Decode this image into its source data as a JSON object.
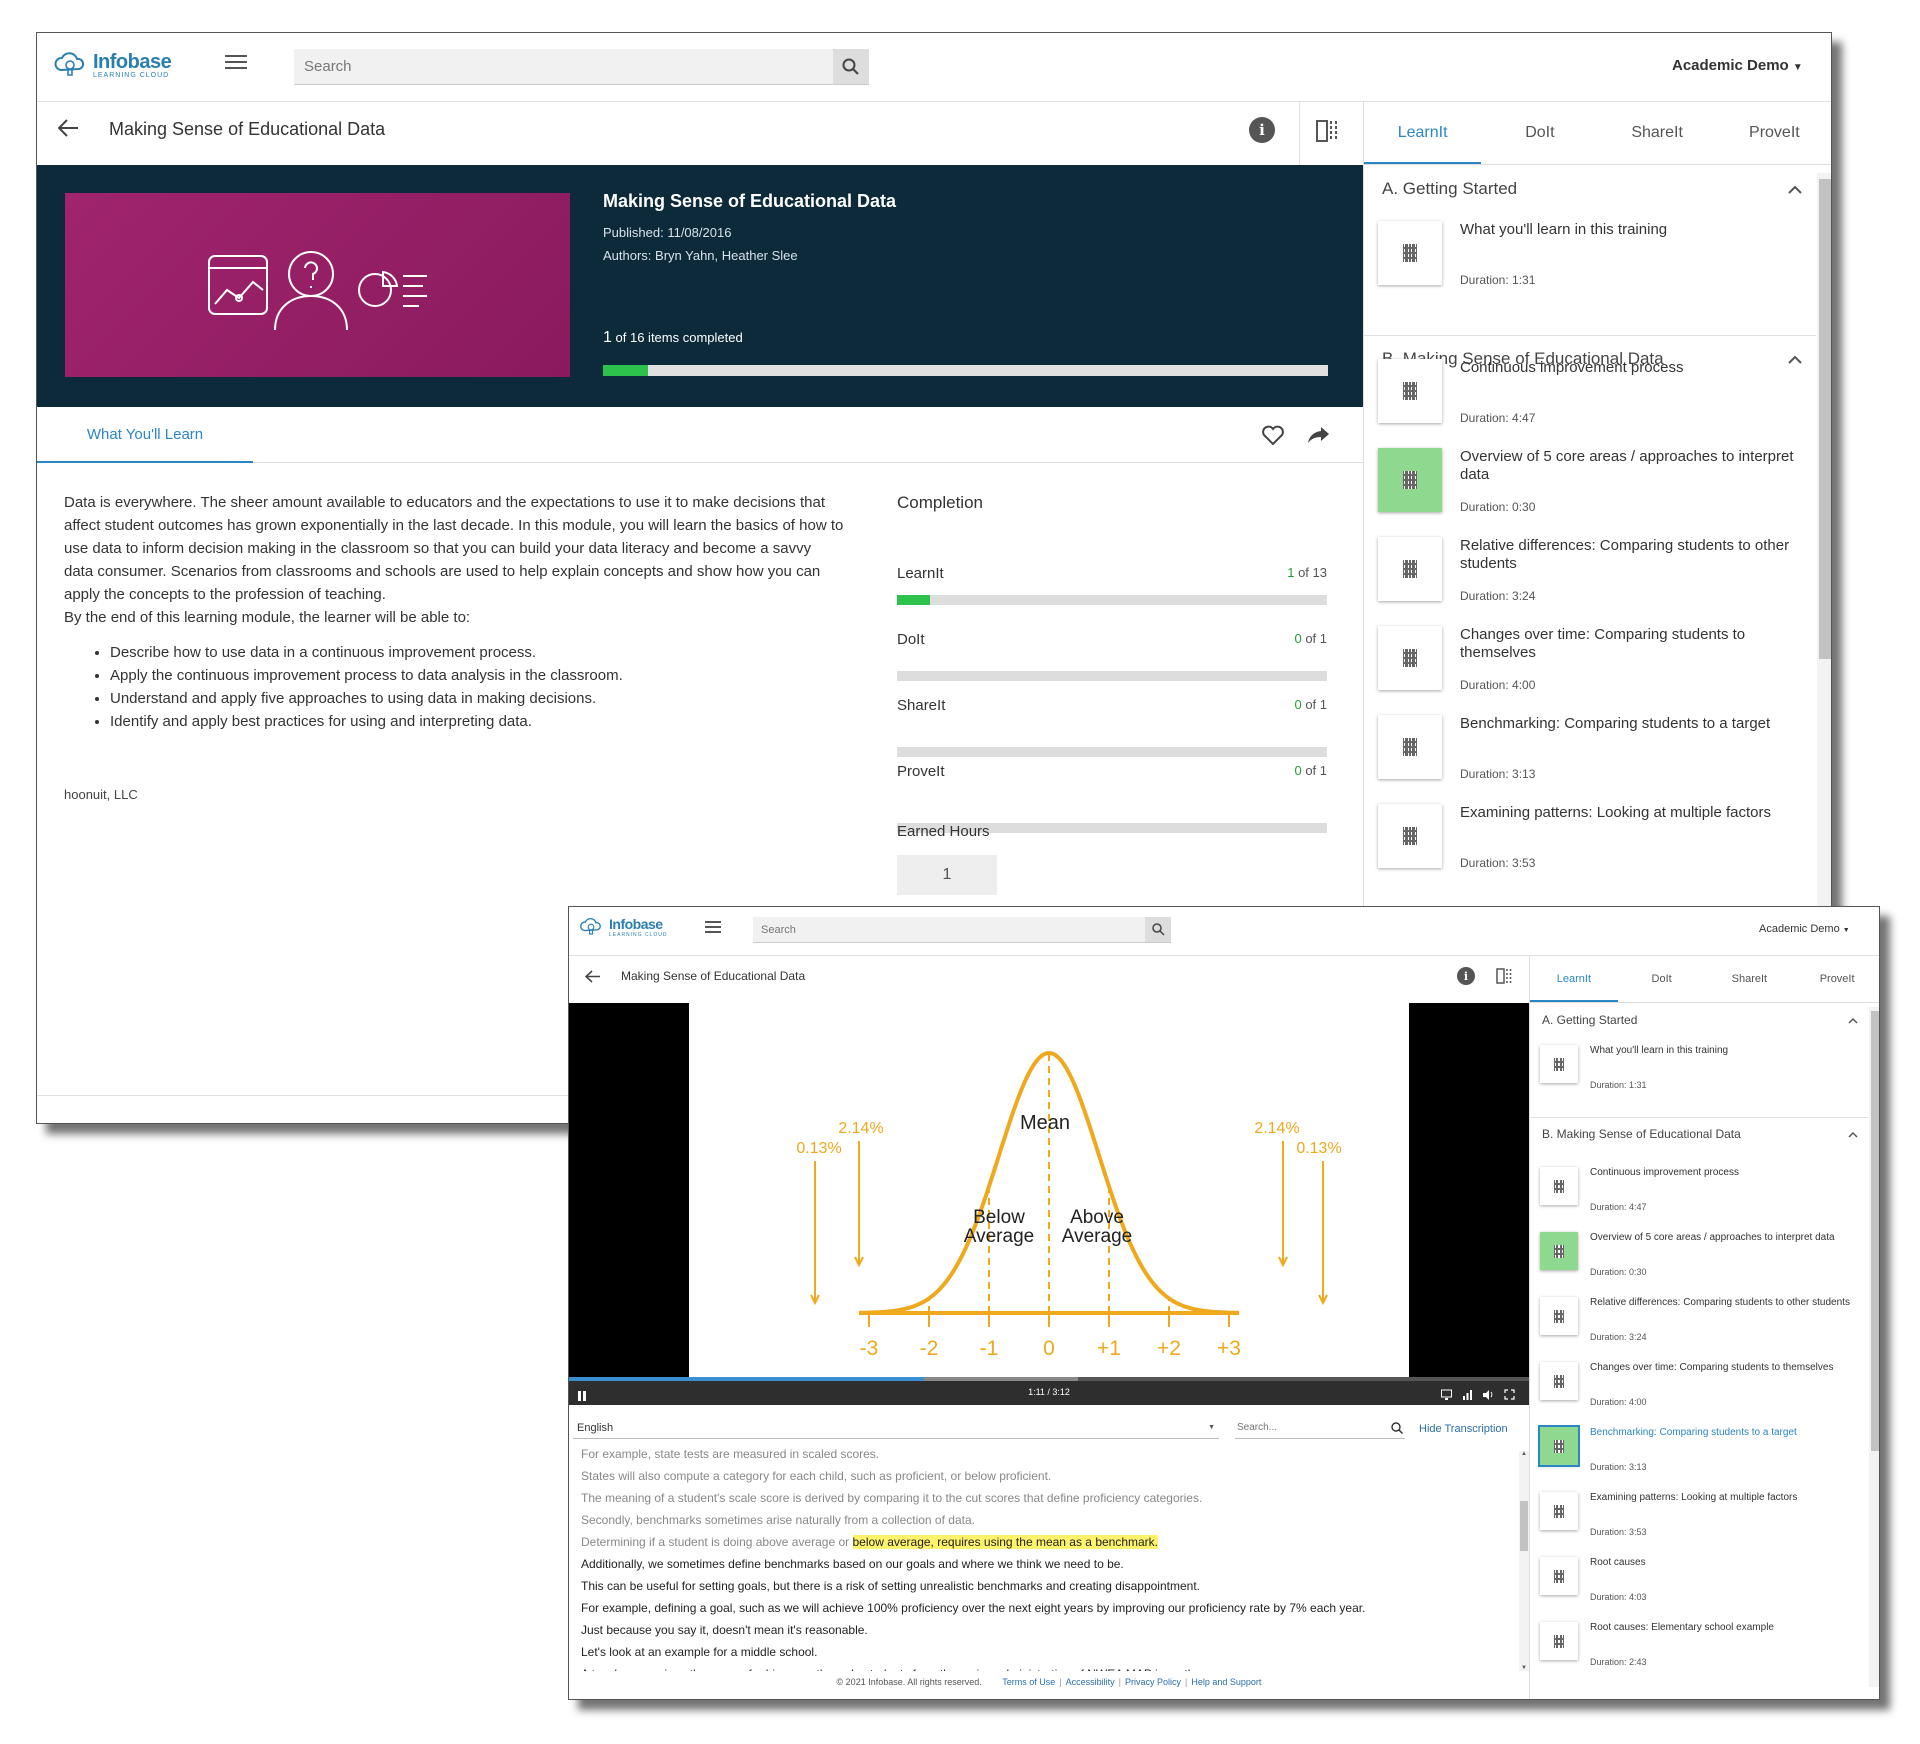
{
  "a": {
    "brand": "Infobase",
    "brand_sub": "LEARNING CLOUD",
    "search_placeholder": "Search",
    "user": "Academic Demo",
    "page_title": "Making Sense of Educational Data",
    "hero": {
      "title": "Making Sense of Educational Data",
      "published": "Published: 11/08/2016",
      "authors": "Authors: Bryn Yahn, Heather Slee",
      "progress_count": "1",
      "progress_text": "of 16 items completed",
      "progress_fraction": 0.0625
    },
    "tab_what": "What You'll Learn",
    "description": "Data is everywhere. The sheer amount available to educators and the expectations to use it to make decisions that affect student outcomes has grown exponentially in the last decade.  In this module, you will learn the basics of how to use data to inform decision making in the classroom so that you can build your data literacy and become a savvy data consumer.  Scenarios from classrooms and schools are used to help explain concepts and show how you can apply the concepts to the profession of teaching.",
    "description2": "By the end of this learning module, the learner will be able to:",
    "bullets": [
      "Describe how to use data in a continuous improvement process.",
      "Apply the continuous improvement process to data analysis in the classroom.",
      "Understand and apply five approaches to using data in making decisions.",
      "Identify and apply best practices for using and interpreting data."
    ],
    "publisher": "hoonuit, LLC",
    "completion_title": "Completion",
    "completion": [
      {
        "label": "LearnIt",
        "count": "1",
        "total": " of 13",
        "fraction": 0.077
      },
      {
        "label": "DoIt",
        "count": "0",
        "total": " of 1",
        "fraction": 0
      },
      {
        "label": "ShareIt",
        "count": "0",
        "total": " of 1",
        "fraction": 0
      },
      {
        "label": "ProveIt",
        "count": "0",
        "total": " of 1",
        "fraction": 0
      }
    ],
    "earned_label": "Earned Hours",
    "earned_value": "1",
    "tabs": [
      "LearnIt",
      "DoIt",
      "ShareIt",
      "ProveIt"
    ],
    "section_a": "A. Getting Started",
    "section_b": "B. Making Sense of Educational Data",
    "items_a": [
      {
        "title": "What you'll learn in this training",
        "duration": "Duration: 1:31"
      }
    ],
    "items_b": [
      {
        "title": "Continuous improvement process",
        "duration": "Duration: 4:47",
        "done": false
      },
      {
        "title": "Overview of 5 core areas / approaches to interpret data",
        "duration": "Duration: 0:30",
        "done": true
      },
      {
        "title": "Relative differences: Comparing students to other students",
        "duration": "Duration: 3:24",
        "done": false
      },
      {
        "title": "Changes over time: Comparing students to themselves",
        "duration": "Duration: 4:00",
        "done": false
      },
      {
        "title": "Benchmarking: Comparing students to a target",
        "duration": "Duration: 3:13",
        "done": false
      },
      {
        "title": "Examining patterns: Looking at multiple factors",
        "duration": "Duration: 3:53",
        "done": false
      }
    ]
  },
  "b": {
    "brand": "Infobase",
    "brand_sub": "LEARNING CLOUD",
    "search_placeholder": "Search",
    "user": "Academic Demo",
    "page_title": "Making Sense of Educational Data",
    "tabs": [
      "LearnIt",
      "DoIt",
      "ShareIt",
      "ProveIt"
    ],
    "section_a": "A. Getting Started",
    "section_b": "B. Making Sense of Educational Data",
    "items_a": [
      {
        "title": "What you'll learn in this training",
        "duration": "Duration: 1:31"
      }
    ],
    "items_b": [
      {
        "title": "Continuous improvement process",
        "duration": "Duration: 4:47",
        "done": false,
        "active": false
      },
      {
        "title": "Overview of 5 core areas / approaches to interpret data",
        "duration": "Duration: 0:30",
        "done": true,
        "active": false
      },
      {
        "title": "Relative differences: Comparing students to other students",
        "duration": "Duration: 3:24",
        "done": false,
        "active": false
      },
      {
        "title": "Changes over time: Comparing students to themselves",
        "duration": "Duration: 4:00",
        "done": false,
        "active": false
      },
      {
        "title": "Benchmarking: Comparing students to a target",
        "duration": "Duration: 3:13",
        "done": true,
        "active": true
      },
      {
        "title": "Examining patterns: Looking at multiple factors",
        "duration": "Duration: 3:53",
        "done": false,
        "active": false
      },
      {
        "title": "Root causes",
        "duration": "Duration: 4:03",
        "done": false,
        "active": false
      },
      {
        "title": "Root causes: Elementary school example",
        "duration": "Duration: 2:43",
        "done": false,
        "active": false
      }
    ],
    "video": {
      "time": "1:11 / 3:12",
      "played_fraction": 0.37,
      "buffered_fraction": 0.53,
      "chart": {
        "mean": "Mean",
        "below": [
          "Below",
          "Average"
        ],
        "above": [
          "Above",
          "Average"
        ],
        "ticks": [
          "-3",
          "-2",
          "-1",
          "0",
          "+1",
          "+2",
          "+3"
        ],
        "pct_outer": "0.13%",
        "pct_inner": "2.14%"
      }
    },
    "language": "English",
    "transcript_search_placeholder": "Search...",
    "hide_transcription": "Hide Transcription",
    "transcript": [
      {
        "text": "For example, state tests are measured in scaled scores.",
        "past": true
      },
      {
        "text": "States will also compute a category for  each child, such as proficient, or below proficient.",
        "past": true
      },
      {
        "text": "The meaning of a student's scale score  is derived by comparing it to the cut scores that define proficiency categories.",
        "past": true
      },
      {
        "text": "Secondly, benchmarks sometimes arise naturally from a collection of data.",
        "past": true
      },
      {
        "text": "Determining if a student is doing above average or ",
        "past": true,
        "highlight": "below average, requires using the mean as a benchmark."
      },
      {
        "text": "Additionally, we sometimes define benchmarks based on our goals and  where we think we need to be.",
        "past": false
      },
      {
        "text": "This can be useful for setting goals, but  there is a risk of setting unrealistic benchmarks and creating disappointment.",
        "past": false
      },
      {
        "text": "For example, defining a goal, such as we will achieve 100% proficiency over  the next eight years by improving our proficiency rate by 7% each year.",
        "past": false
      },
      {
        "text": "Just because you say it, doesn't mean it's reasonable.",
        "past": false
      },
      {
        "text": "Let's look at an example for a middle school.",
        "past": false
      },
      {
        "text": "A teacher examines the scores for  his seventh grade students from the spring administration of NWEA MAP in math.",
        "past": false
      }
    ],
    "footer": {
      "copyright": "© 2021 Infobase. All rights reserved.",
      "links": [
        "Terms of Use",
        "Accessibility",
        "Privacy Policy",
        "Help and Support"
      ]
    }
  }
}
